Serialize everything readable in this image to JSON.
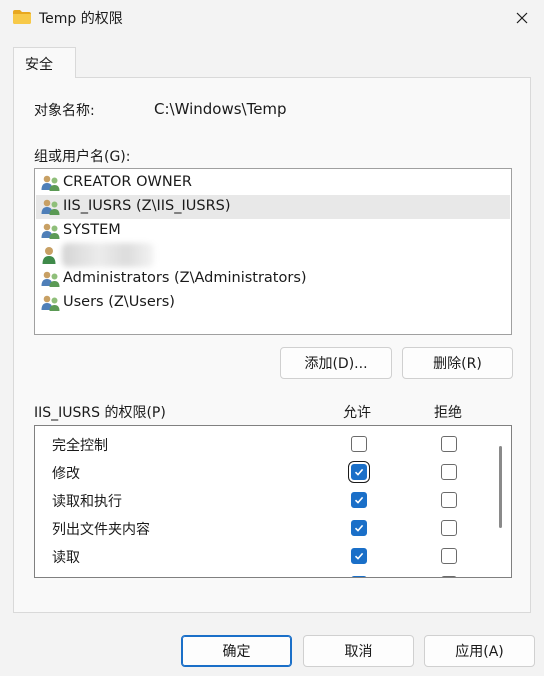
{
  "window": {
    "title": "Temp 的权限",
    "icon": "folder-icon",
    "close_icon": "close-icon"
  },
  "tabs": [
    {
      "label": "安全"
    }
  ],
  "object": {
    "label": "对象名称:",
    "value": "C:\\Windows\\Temp"
  },
  "group": {
    "label": "组或用户名(G):",
    "items": [
      {
        "name": "CREATOR OWNER",
        "icon": "user-group-icon"
      },
      {
        "name": "IIS_IUSRS (Z\\IIS_IUSRS)",
        "icon": "user-group-icon"
      },
      {
        "name": "SYSTEM",
        "icon": "user-group-icon"
      },
      {
        "name": "",
        "icon": "user-icon"
      },
      {
        "name": "Administrators (Z\\Administrators)",
        "icon": "user-group-icon"
      },
      {
        "name": "Users (Z\\Users)",
        "icon": "user-group-icon"
      }
    ],
    "add_label": "添加(D)...",
    "remove_label": "删除(R)"
  },
  "permissions": {
    "label": "IIS_IUSRS 的权限(P)",
    "allow_label": "允许",
    "deny_label": "拒绝",
    "rows": [
      {
        "name": "完全控制",
        "allow": false,
        "deny": false
      },
      {
        "name": "修改",
        "allow": true,
        "deny": false
      },
      {
        "name": "读取和执行",
        "allow": true,
        "deny": false
      },
      {
        "name": "列出文件夹内容",
        "allow": true,
        "deny": false
      },
      {
        "name": "读取",
        "allow": true,
        "deny": false
      }
    ]
  },
  "footer": {
    "ok": "确定",
    "cancel": "取消",
    "apply": "应用(A)"
  },
  "colors": {
    "accent": "#1a6fc8",
    "folder": "#f3c24b"
  }
}
